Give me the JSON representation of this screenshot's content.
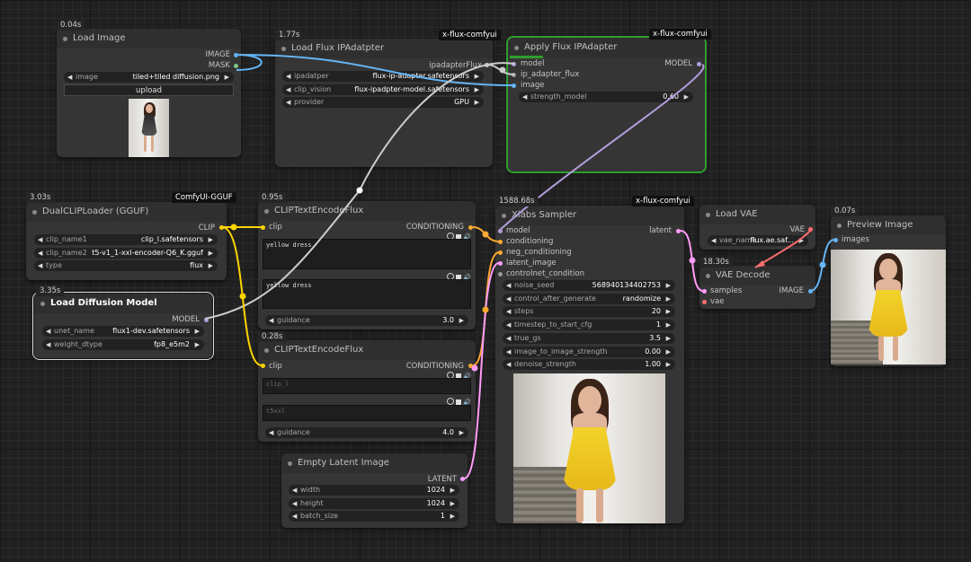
{
  "colors": {
    "image": "#64b5f6",
    "mask": "#81c784",
    "clip": "#ffd500",
    "conditioning": "#ffa931",
    "latent": "#ff9cf9",
    "model": "#b39ddb",
    "vae": "#ff6e6e",
    "other": "#9a9a9a",
    "flux_link": "#cccccc"
  },
  "nodes": {
    "load_image": {
      "timing": "0.04s",
      "title": "Load Image",
      "outputs": [
        "IMAGE",
        "MASK"
      ],
      "widget_label": "image",
      "widget_value": "tiled+tiled diffusion.png",
      "upload_label": "upload"
    },
    "load_flux_ipadapter": {
      "timing": "1.77s",
      "badge": "x-flux-comfyui",
      "title": "Load Flux IPAdatpter",
      "output": "ipadapterFlux",
      "widgets": [
        {
          "label": "ipadatper",
          "value": "flux-ip-adapter.safetensors"
        },
        {
          "label": "clip_vision",
          "value": "flux-ipadpter-model.safetensors"
        },
        {
          "label": "provider",
          "value": "GPU"
        }
      ]
    },
    "apply_flux_ipadapter": {
      "badge": "x-flux-comfyui",
      "title": "Apply Flux IPAdapter",
      "inputs": [
        "model",
        "ip_adapter_flux",
        "image"
      ],
      "output": "MODEL",
      "widget": {
        "label": "strength_model",
        "value": "0.60"
      }
    },
    "dual_clip": {
      "timing": "3.03s",
      "badge": "ComfyUI-GGUF",
      "title": "DualCLIPLoader (GGUF)",
      "output": "CLIP",
      "widgets": [
        {
          "label": "clip_name1",
          "value": "clip_l.safetensors"
        },
        {
          "label": "clip_name2",
          "value": "t5-v1_1-xxl-encoder-Q6_K.gguf"
        },
        {
          "label": "type",
          "value": "flux"
        }
      ]
    },
    "load_diffusion": {
      "timing": "3.35s",
      "title": "Load Diffusion Model",
      "output": "MODEL",
      "widgets": [
        {
          "label": "unet_name",
          "value": "flux1-dev.safetensors"
        },
        {
          "label": "weight_dtype",
          "value": "fp8_e5m2"
        }
      ]
    },
    "clip_text_1": {
      "timing": "0.95s",
      "title": "CLIPTextEncodeFlux",
      "input": "clip",
      "output": "CONDITIONING",
      "text1": "yellow dress",
      "text2": "yellow dress",
      "widget": {
        "label": "guidance",
        "value": "3.0"
      }
    },
    "clip_text_2": {
      "timing": "0.28s",
      "title": "CLIPTextEncodeFlux",
      "input": "clip",
      "output": "CONDITIONING",
      "text1_placeholder": "clip_l",
      "text2_placeholder": "t5xxl",
      "widget": {
        "label": "guidance",
        "value": "4.0"
      }
    },
    "empty_latent": {
      "title": "Empty Latent Image",
      "output": "LATENT",
      "widgets": [
        {
          "label": "width",
          "value": "1024"
        },
        {
          "label": "height",
          "value": "1024"
        },
        {
          "label": "batch_size",
          "value": "1"
        }
      ]
    },
    "xlabs_sampler": {
      "timing": "1588.68s",
      "badge": "x-flux-comfyui",
      "title": "Xlabs Sampler",
      "inputs": [
        "model",
        "conditioning",
        "neg_conditioning",
        "latent_image",
        "controlnet_condition"
      ],
      "output": "latent",
      "widgets": [
        {
          "label": "noise_seed",
          "value": "568940134402753"
        },
        {
          "label": "control_after_generate",
          "value": "randomize"
        },
        {
          "label": "steps",
          "value": "20"
        },
        {
          "label": "timestep_to_start_cfg",
          "value": "1"
        },
        {
          "label": "true_gs",
          "value": "3.5"
        },
        {
          "label": "image_to_image_strength",
          "value": "0.00"
        },
        {
          "label": "denoise_strength",
          "value": "1.00"
        }
      ]
    },
    "load_vae": {
      "title": "Load VAE",
      "output": "VAE",
      "widget": {
        "label": "vae_name",
        "value": "flux.ae.saf..."
      }
    },
    "vae_decode": {
      "timing": "18.30s",
      "title": "VAE Decode",
      "inputs": [
        "samples",
        "vae"
      ],
      "output": "IMAGE"
    },
    "preview_image": {
      "timing": "0.07s",
      "title": "Preview Image",
      "input": "images"
    }
  }
}
